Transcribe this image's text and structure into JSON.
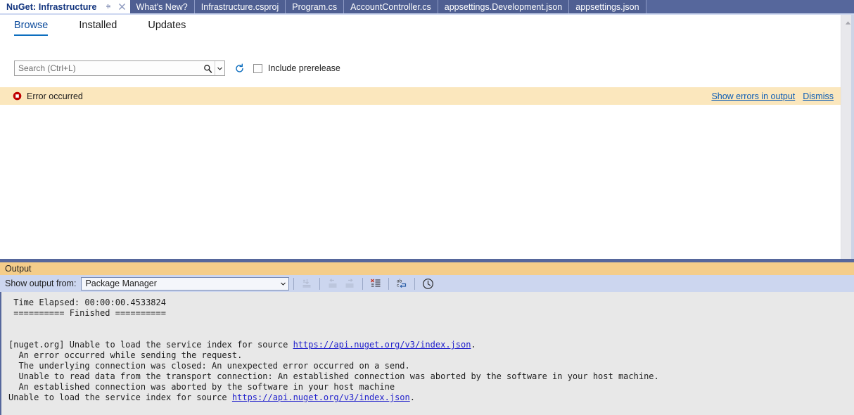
{
  "window": {
    "tabs": [
      {
        "label": "NuGet: Infrastructure",
        "active": true,
        "pin_icon": "pin-icon",
        "close_icon": "close-icon"
      },
      {
        "label": "What's New?",
        "active": false
      },
      {
        "label": "Infrastructure.csproj",
        "active": false
      },
      {
        "label": "Program.cs",
        "active": false
      },
      {
        "label": "AccountController.cs",
        "active": false
      },
      {
        "label": "appsettings.Development.json",
        "active": false
      },
      {
        "label": "appsettings.json",
        "active": false
      }
    ]
  },
  "nuget": {
    "mode_tabs": [
      {
        "label": "Browse",
        "selected": true
      },
      {
        "label": "Installed",
        "selected": false
      },
      {
        "label": "Updates",
        "selected": false
      }
    ],
    "search": {
      "value": "",
      "placeholder": "Search (Ctrl+L)",
      "magnifier_icon": "search-icon",
      "dropdown_icon": "chevron-down-icon"
    },
    "refresh_icon": "refresh-icon",
    "prerelease": {
      "label": "Include prerelease",
      "checked": false
    },
    "error_bar": {
      "icon": "error-circle-icon",
      "message": "Error occurred",
      "show_errors_link": "Show errors in output",
      "dismiss_link": "Dismiss"
    },
    "scrollbar": {
      "up_arrow_icon": "scroll-up-arrow-icon"
    }
  },
  "output": {
    "title": "Output",
    "toolbar": {
      "show_output_from_label": "Show output from:",
      "selected_source": "Package Manager",
      "dropdown_icon": "chevron-down-icon",
      "buttons": [
        {
          "name": "go-to-message-icon",
          "enabled": false
        },
        {
          "name": "previous-message-icon",
          "enabled": false
        },
        {
          "name": "next-message-icon",
          "enabled": false
        },
        {
          "name": "clear-all-icon",
          "enabled": true
        },
        {
          "name": "toggle-word-wrap-icon",
          "enabled": true
        },
        {
          "name": "show-timestamps-icon",
          "enabled": true
        }
      ]
    },
    "lines": [
      {
        "text": " Time Elapsed: 00:00:00.4533824"
      },
      {
        "text": " ========== Finished =========="
      },
      {
        "text": ""
      },
      {
        "text": ""
      },
      {
        "pre": "[nuget.org] Unable to load the service index for source ",
        "link": "https://api.nuget.org/v3/index.json",
        "post": "."
      },
      {
        "text": "  An error occurred while sending the request."
      },
      {
        "text": "  The underlying connection was closed: An unexpected error occurred on a send."
      },
      {
        "text": "  Unable to read data from the transport connection: An established connection was aborted by the software in your host machine."
      },
      {
        "text": "  An established connection was aborted by the software in your host machine"
      },
      {
        "pre": "Unable to load the service index for source ",
        "link": "https://api.nuget.org/v3/index.json",
        "post": "."
      }
    ]
  },
  "colors": {
    "tabstrip_bg": "#56679c",
    "tab_inactive_bg": "#4f5f92",
    "accent_blue": "#0d6ebf",
    "error_bar_bg": "#fbe7bd",
    "error_icon": "#c00000",
    "output_header_bg": "#f4cd8a",
    "output_toolbar_bg": "#ccd6ef",
    "output_body_bg": "#e8e8e8",
    "link_blue": "#2222cc"
  }
}
